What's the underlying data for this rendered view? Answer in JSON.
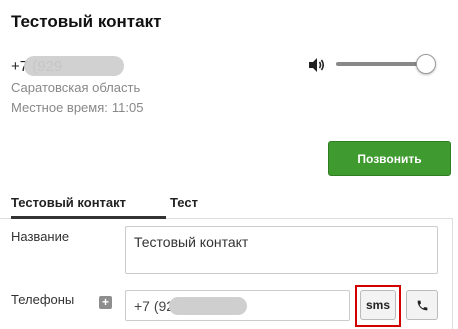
{
  "contact": {
    "title": "Тестовый контакт",
    "phone_prefix": "+7 (929",
    "region": "Саратовская область",
    "local_time_label": "Местное время:",
    "local_time_value": "11:05"
  },
  "volume": {
    "icon": "volume-icon",
    "level": 0.9
  },
  "actions": {
    "call_label": "Позвонить"
  },
  "tabs": [
    {
      "label": "Тестовый контакт",
      "active": true
    },
    {
      "label": "Тест",
      "active": false
    }
  ],
  "form": {
    "name_label": "Название",
    "name_value": "Тестовый контакт",
    "phones_label": "Телефоны",
    "phone_value_prefix": "+7 (92",
    "sms_label": "sms",
    "add_icon": "plus-icon",
    "call_icon": "phone-icon"
  },
  "colors": {
    "call_button": "#3f9a2f",
    "highlight": "#d40000"
  }
}
